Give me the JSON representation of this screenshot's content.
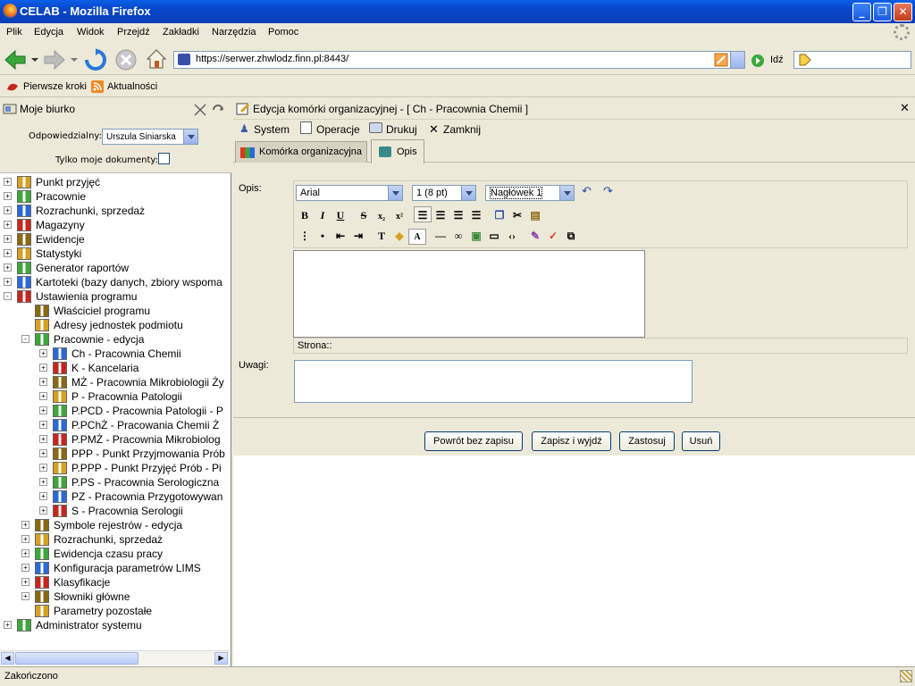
{
  "window": {
    "title": "CELAB - Mozilla Firefox"
  },
  "menu": [
    "Plik",
    "Edycja",
    "Widok",
    "Przejdź",
    "Zakładki",
    "Narzędzia",
    "Pomoc"
  ],
  "nav": {
    "url": "https://serwer.zhwlodz.finn.pl:8443/",
    "go_label": "Idź"
  },
  "bookmarks": [
    "Pierwsze kroki",
    "Aktualności"
  ],
  "left": {
    "title": "Moje biurko",
    "responsible_label": "Odpowiedzialny:",
    "responsible_value": "Urszula Siniarska",
    "only_mine_label": "Tylko moje dokumenty:",
    "tree": [
      {
        "label": "Punkt przyjęć",
        "level": 0,
        "exp": "+"
      },
      {
        "label": "Pracownie",
        "level": 0,
        "exp": "+"
      },
      {
        "label": "Rozrachunki, sprzedaż",
        "level": 0,
        "exp": "+"
      },
      {
        "label": "Magazyny",
        "level": 0,
        "exp": "+"
      },
      {
        "label": "Ewidencje",
        "level": 0,
        "exp": "+"
      },
      {
        "label": "Statystyki",
        "level": 0,
        "exp": "+"
      },
      {
        "label": "Generator raportów",
        "level": 0,
        "exp": "+"
      },
      {
        "label": "Kartoteki (bazy danych, zbiory wspoma",
        "level": 0,
        "exp": "+"
      },
      {
        "label": "Ustawienia programu",
        "level": 0,
        "exp": "-"
      },
      {
        "label": "Właściciel programu",
        "level": 1,
        "exp": ""
      },
      {
        "label": "Adresy jednostek podmiotu",
        "level": 1,
        "exp": ""
      },
      {
        "label": "Pracownie - edycja",
        "level": 1,
        "exp": "-"
      },
      {
        "label": "Ch - Pracownia Chemii",
        "level": 2,
        "exp": "+"
      },
      {
        "label": "K - Kancelaria",
        "level": 2,
        "exp": "+"
      },
      {
        "label": "MŻ - Pracownia Mikrobiologii Ży",
        "level": 2,
        "exp": "+"
      },
      {
        "label": "P - Pracownia Patologii",
        "level": 2,
        "exp": "+"
      },
      {
        "label": "P.PCD - Pracownia Patologii - P",
        "level": 2,
        "exp": "+"
      },
      {
        "label": "P.PChŻ - Pracowania Chemii Ż",
        "level": 2,
        "exp": "+"
      },
      {
        "label": "P.PMŻ - Pracownia Mikrobiolog",
        "level": 2,
        "exp": "+"
      },
      {
        "label": "PPP - Punkt Przyjmowania Prób",
        "level": 2,
        "exp": "+"
      },
      {
        "label": "P.PPP - Punkt Przyjęć Prób - Pi",
        "level": 2,
        "exp": "+"
      },
      {
        "label": "P.PS - Pracownia Serologiczna",
        "level": 2,
        "exp": "+"
      },
      {
        "label": "PZ - Pracownia Przygotowywan",
        "level": 2,
        "exp": "+"
      },
      {
        "label": "S - Pracownia Serologii",
        "level": 2,
        "exp": "+"
      },
      {
        "label": "Symbole rejestrów - edycja",
        "level": 1,
        "exp": "+"
      },
      {
        "label": "Rozrachunki, sprzedaż",
        "level": 1,
        "exp": "+"
      },
      {
        "label": "Ewidencja czasu pracy",
        "level": 1,
        "exp": "+"
      },
      {
        "label": "Konfiguracja parametrów LIMS",
        "level": 1,
        "exp": "+"
      },
      {
        "label": "Klasyfikacje",
        "level": 1,
        "exp": "+"
      },
      {
        "label": "Słowniki główne",
        "level": 1,
        "exp": "+"
      },
      {
        "label": "Parametry pozostałe",
        "level": 1,
        "exp": ""
      },
      {
        "label": "Administrator systemu",
        "level": 0,
        "exp": "+"
      }
    ]
  },
  "dialog": {
    "title": "Edycja komórki organizacyjnej - [ Ch - Pracownia Chemii ]",
    "toolbar": [
      "System",
      "Operacje",
      "Drukuj",
      "Zamknij"
    ],
    "tabs": [
      "Komórka organizacyjna",
      "Opis"
    ],
    "opis_label": "Opis:",
    "font_value": "Arial",
    "size_value": "1 (8 pt)",
    "style_value": "Nagłówek 1",
    "page_label": "Strona::",
    "uwagi_label": "Uwagi:",
    "buttons": [
      "Powrót bez zapisu",
      "Zapisz i wyjdź",
      "Zastosuj",
      "Usuń"
    ]
  },
  "status": {
    "text": "Zakończono"
  }
}
